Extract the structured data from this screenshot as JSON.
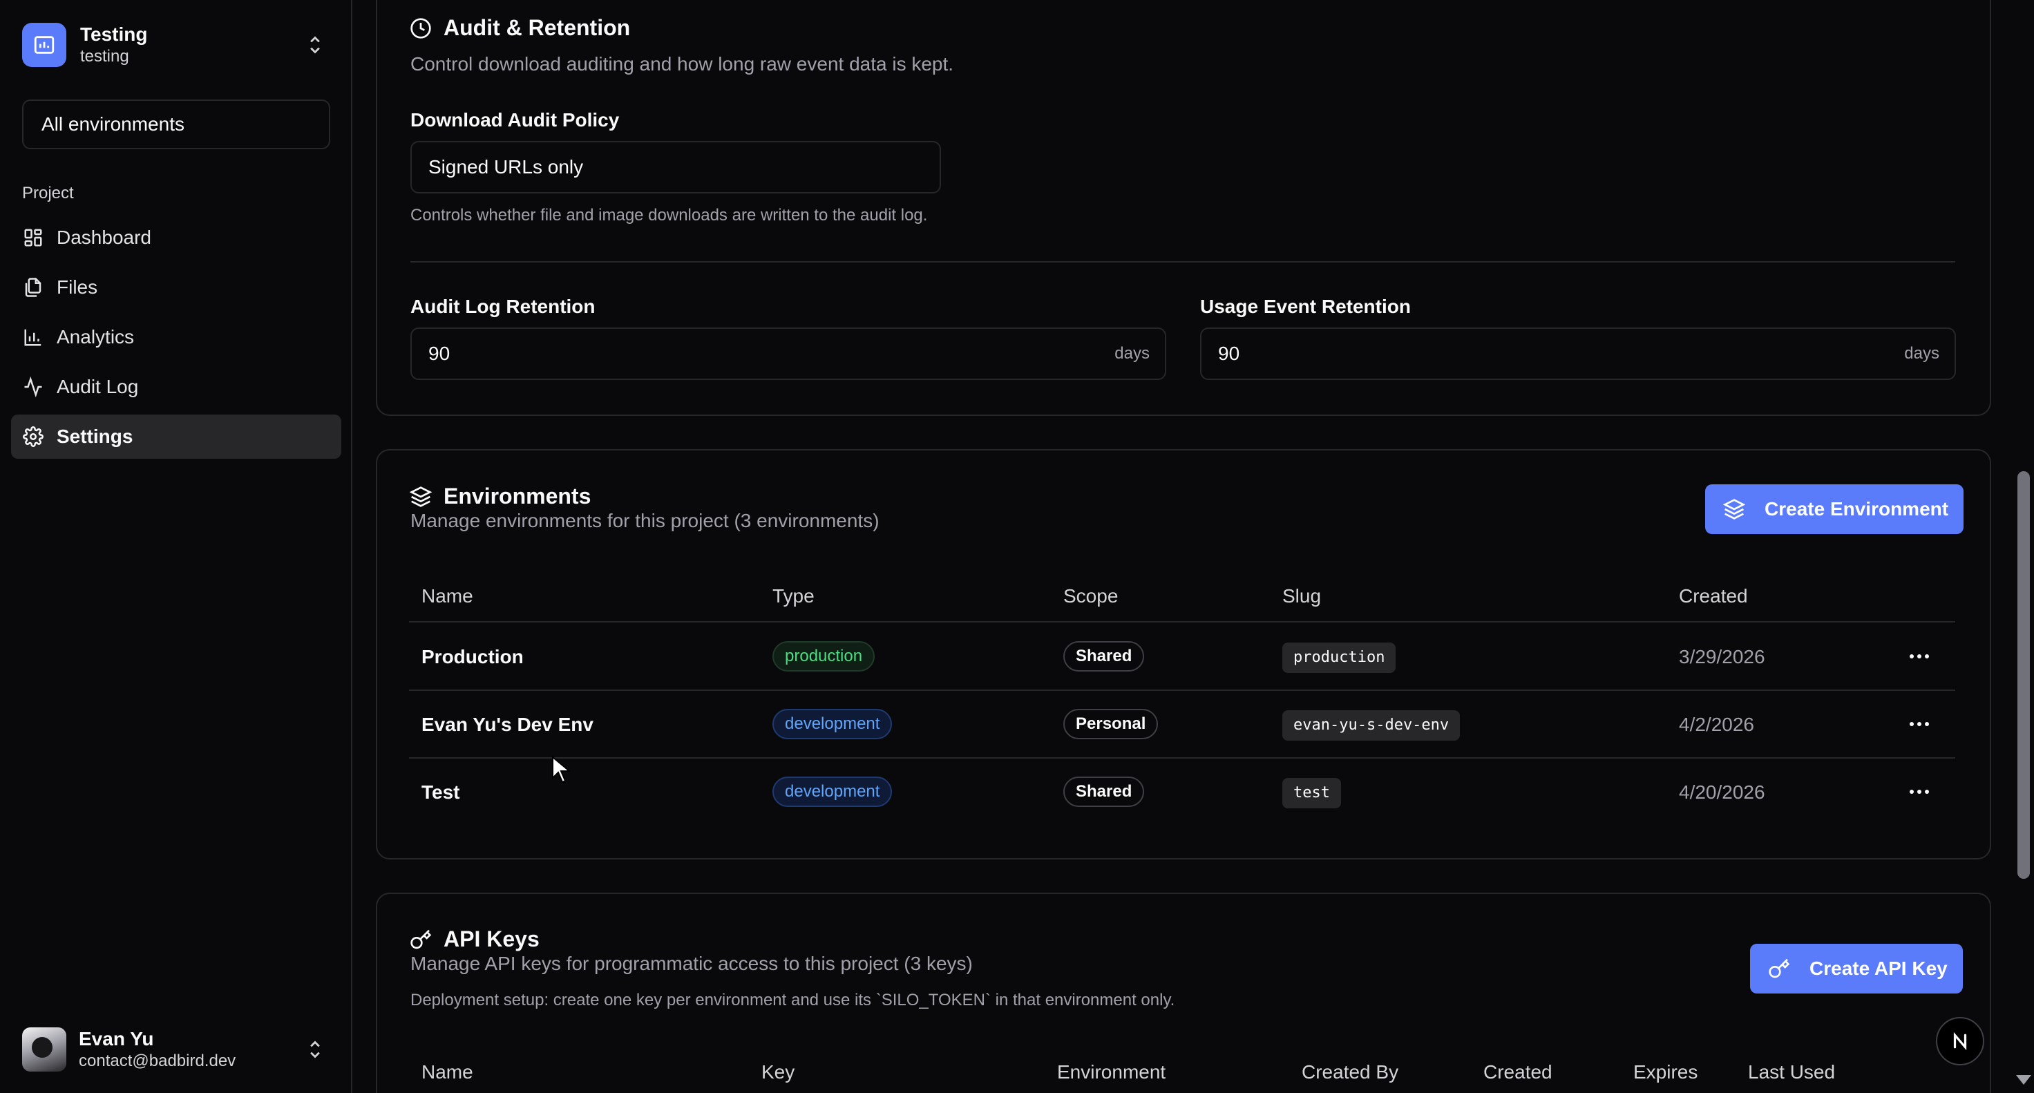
{
  "project": {
    "name": "Testing",
    "slug": "testing"
  },
  "env_filter": "All environments",
  "nav": {
    "section": "Project",
    "items": [
      {
        "label": "Dashboard",
        "icon": "dashboard-icon"
      },
      {
        "label": "Files",
        "icon": "files-icon"
      },
      {
        "label": "Analytics",
        "icon": "analytics-icon"
      },
      {
        "label": "Audit Log",
        "icon": "activity-icon"
      },
      {
        "label": "Settings",
        "icon": "gear-icon",
        "active": true
      }
    ]
  },
  "user": {
    "name": "Evan Yu",
    "email": "contact@badbird.dev"
  },
  "audit": {
    "title": "Audit & Retention",
    "description": "Control download auditing and how long raw event data is kept.",
    "policy_label": "Download Audit Policy",
    "policy_value": "Signed URLs only",
    "policy_helper": "Controls whether file and image downloads are written to the audit log.",
    "log_retention_label": "Audit Log Retention",
    "log_retention_value": "90",
    "usage_retention_label": "Usage Event Retention",
    "usage_retention_value": "90",
    "unit": "days"
  },
  "environments": {
    "title": "Environments",
    "description": "Manage environments for this project (3 environments)",
    "create_label": "Create Environment",
    "columns": [
      "Name",
      "Type",
      "Scope",
      "Slug",
      "Created"
    ],
    "rows": [
      {
        "name": "Production",
        "type": "production",
        "scope": "Shared",
        "slug": "production",
        "created": "3/29/2026"
      },
      {
        "name": "Evan Yu's Dev Env",
        "type": "development",
        "scope": "Personal",
        "slug": "evan-yu-s-dev-env",
        "created": "4/2/2026"
      },
      {
        "name": "Test",
        "type": "development",
        "scope": "Shared",
        "slug": "test",
        "created": "4/20/2026"
      }
    ]
  },
  "api_keys": {
    "title": "API Keys",
    "description": "Manage API keys for programmatic access to this project (3 keys)",
    "helper": "Deployment setup: create one key per environment and use its `SILO_TOKEN` in that environment only.",
    "create_label": "Create API Key",
    "columns": [
      "Name",
      "Key",
      "Environment",
      "Created By",
      "Created",
      "Expires",
      "Last Used"
    ]
  },
  "colors": {
    "accent": "#5b7cfa",
    "background": "#09090b",
    "border": "#27272a",
    "production": "#4ade80",
    "development": "#60a5fa"
  }
}
